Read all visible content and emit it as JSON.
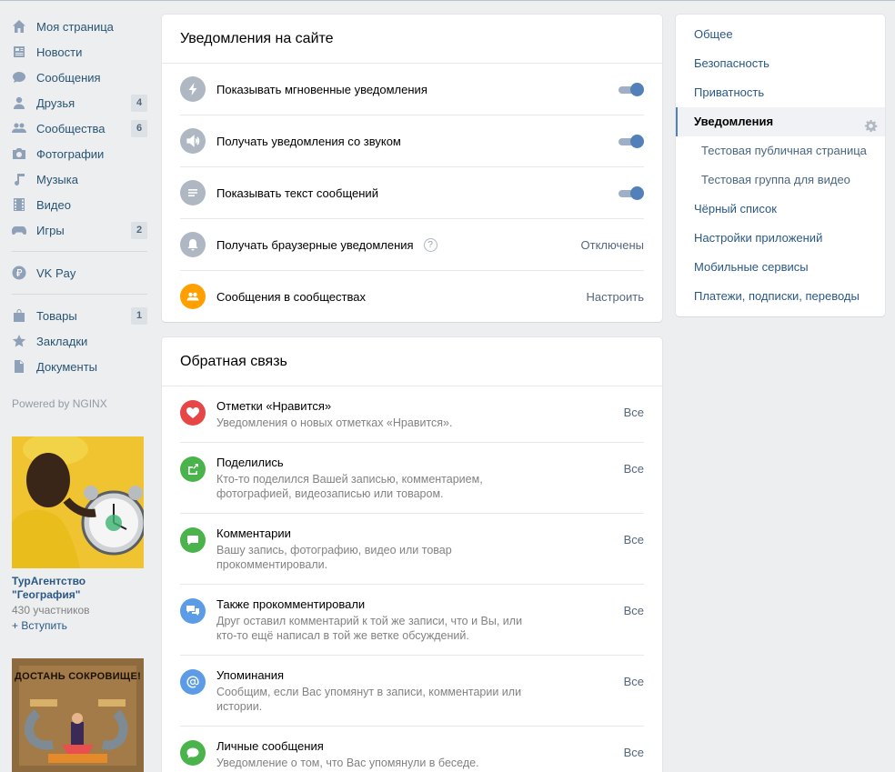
{
  "left_menu": {
    "items": [
      {
        "label": "Моя страница",
        "icon": "home-icon"
      },
      {
        "label": "Новости",
        "icon": "news-icon"
      },
      {
        "label": "Сообщения",
        "icon": "messages-icon"
      },
      {
        "label": "Друзья",
        "icon": "friends-icon",
        "badge": "4"
      },
      {
        "label": "Сообщества",
        "icon": "communities-icon",
        "badge": "6"
      },
      {
        "label": "Фотографии",
        "icon": "camera-icon"
      },
      {
        "label": "Музыка",
        "icon": "music-note-icon"
      },
      {
        "label": "Видео",
        "icon": "video-film-icon"
      },
      {
        "label": "Игры",
        "icon": "gamepad-icon",
        "badge": "2"
      }
    ],
    "pay": {
      "label": "VK Pay",
      "icon": "ruble-icon"
    },
    "extra": [
      {
        "label": "Товары",
        "icon": "bag-icon",
        "badge": "1"
      },
      {
        "label": "Закладки",
        "icon": "star-icon"
      },
      {
        "label": "Документы",
        "icon": "document-icon"
      }
    ],
    "powered": "Powered by NGINX"
  },
  "ads": [
    {
      "title": "ТурАгентство \"География\"",
      "members": "430 участников",
      "join": "+ Вступить"
    },
    {
      "image_text": "ДОСТАНЬ СОКРОВИЩЕ!"
    }
  ],
  "site_notifications": {
    "title": "Уведомления на сайте",
    "rows": [
      {
        "label": "Показывать мгновенные уведомления",
        "icon": "lightning-icon",
        "toggle_on": true
      },
      {
        "label": "Получать уведомления со звуком",
        "icon": "speaker-icon",
        "toggle_on": true
      },
      {
        "label": "Показывать текст сообщений",
        "icon": "text-lines-icon",
        "toggle_on": true
      },
      {
        "label": "Получать браузерные уведомления",
        "icon": "bell-icon",
        "help": "?",
        "value": "Отключены"
      },
      {
        "label": "Сообщения в сообществах",
        "icon": "group-people-icon",
        "value": "Настроить"
      }
    ]
  },
  "feedback": {
    "title": "Обратная связь",
    "rows": [
      {
        "title": "Отметки «Нравится»",
        "desc": "Уведомления о новых отметках «Нравится».",
        "value": "Все",
        "icon": "heart-icon",
        "color": "#e64646"
      },
      {
        "title": "Поделились",
        "desc": "Кто-то поделился Вашей записью, комментарием, фотографией, видеозаписью или товаром.",
        "value": "Все",
        "icon": "share-icon",
        "color": "#4bb34b"
      },
      {
        "title": "Комментарии",
        "desc": "Вашу запись, фотографию, видео или товар прокомментировали.",
        "value": "Все",
        "icon": "comment-icon",
        "color": "#4bb34b"
      },
      {
        "title": "Также прокомментировали",
        "desc": "Друг оставил комментарий к той же записи, что и Вы, или кто-то ещё написал в той же ветке обсуждений.",
        "value": "Все",
        "icon": "comments-icon",
        "color": "#5c9ce6"
      },
      {
        "title": "Упоминания",
        "desc": "Сообщим, если Вас упомянут в записи, комментарии или истории.",
        "value": "Все",
        "icon": "at-icon",
        "color": "#5c9ce6"
      },
      {
        "title": "Личные сообщения",
        "desc": "Уведомление о том, что Вас упомянули в беседе.",
        "value": "Все",
        "icon": "message-icon",
        "color": "#4bb34b"
      }
    ]
  },
  "right_menu": {
    "items": [
      {
        "label": "Общее"
      },
      {
        "label": "Безопасность"
      },
      {
        "label": "Приватность"
      },
      {
        "label": "Уведомления",
        "active": true
      },
      {
        "label": "Тестовая публичная страница",
        "sub": true
      },
      {
        "label": "Тестовая группа для видео",
        "sub": true
      },
      {
        "label": "Чёрный список"
      },
      {
        "label": "Настройки приложений"
      },
      {
        "label": "Мобильные сервисы"
      },
      {
        "label": "Платежи, подписки, переводы"
      }
    ]
  },
  "colors": {
    "background": "#edeef0",
    "link": "#2a5885",
    "accent": "#5181b8",
    "icon_gray": "#aeb7c2",
    "icon_orange": "#ffa000"
  }
}
